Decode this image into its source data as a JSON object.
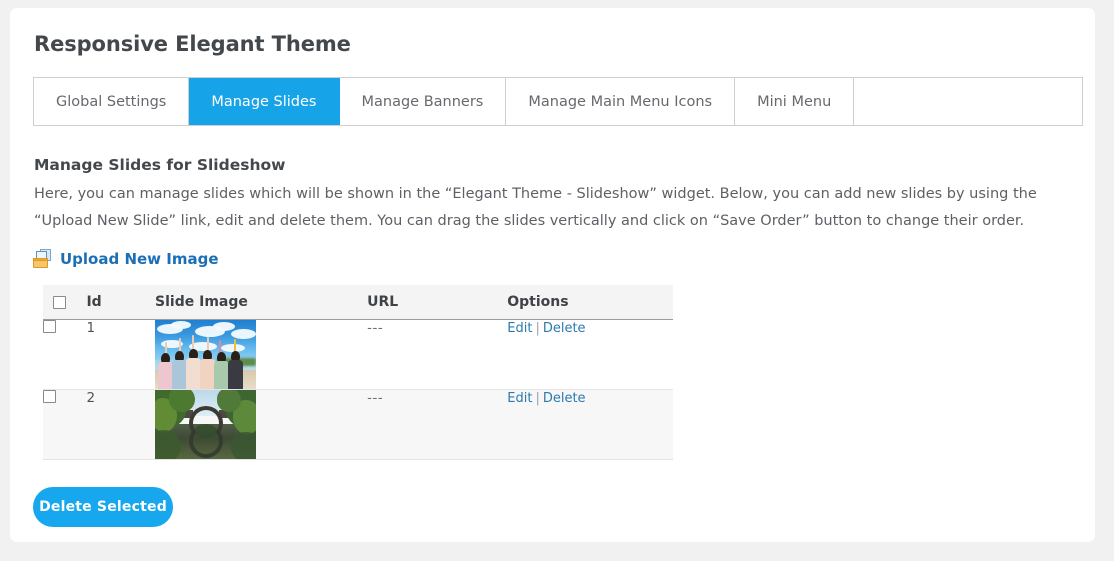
{
  "page": {
    "title": "Responsive Elegant Theme"
  },
  "tabs": [
    {
      "label": "Global Settings",
      "active": false
    },
    {
      "label": "Manage Slides",
      "active": true
    },
    {
      "label": "Manage Banners",
      "active": false
    },
    {
      "label": "Manage Main Menu Icons",
      "active": false
    },
    {
      "label": "Mini Menu",
      "active": false
    }
  ],
  "section": {
    "heading": "Manage Slides for Slideshow",
    "description": "Here, you can manage slides which will be shown in the “Elegant Theme - Slideshow” widget. Below, you can add new slides by using the “Upload New Slide” link, edit and delete them. You can drag the slides vertically and click on “Save Order” button to change their order."
  },
  "upload": {
    "label": "Upload New Image",
    "icon": "add-media-icon"
  },
  "table": {
    "columns": [
      "",
      "Id",
      "Slide Image",
      "URL",
      "Options"
    ],
    "rows": [
      {
        "id": "1",
        "image_alt": "Group of people with raised arms on a beach under a blue cloudy sky",
        "url": "---",
        "edit_label": "Edit",
        "separator": "|",
        "delete_label": "Delete"
      },
      {
        "id": "2",
        "image_alt": "Stone arch bridge reflected in water forming a circle, surrounded by green trees",
        "url": "---",
        "edit_label": "Edit",
        "separator": "|",
        "delete_label": "Delete"
      }
    ]
  },
  "actions": {
    "delete_selected_label": "Delete Selected"
  },
  "colors": {
    "accent": "#17a3e8",
    "button": "#17a7ef",
    "link": "#2a7ab0",
    "upload_link": "#1b6fb5",
    "page_bg": "#f1f1f1",
    "card_bg": "#ffffff",
    "text": "#44484c"
  }
}
